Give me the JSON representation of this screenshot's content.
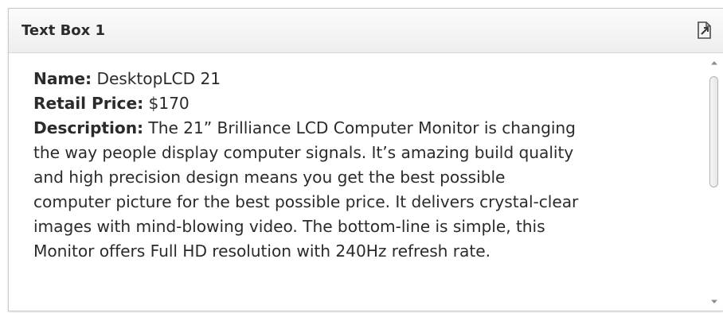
{
  "panel": {
    "title": "Text Box 1",
    "export_icon": "export-document-icon"
  },
  "product": {
    "name_label": "Name:",
    "name_value": " DesktopLCD 21",
    "price_label": "Retail Price:",
    "price_value": " $170",
    "description_label": "Description:",
    "description_lines": [
      " The 21” Brilliance LCD Computer Monitor is changing",
      "the way people display computer signals. It’s amazing build quality",
      "and high precision design means you get the best possible",
      "computer picture for the best possible price. It delivers crystal-clear",
      "images with mind-blowing video. The bottom-line is simple, this",
      "Monitor offers Full HD resolution with 240Hz refresh rate."
    ]
  },
  "scrollbar": {
    "up_icon": "triangle-up-icon",
    "down_icon": "triangle-down-icon"
  }
}
